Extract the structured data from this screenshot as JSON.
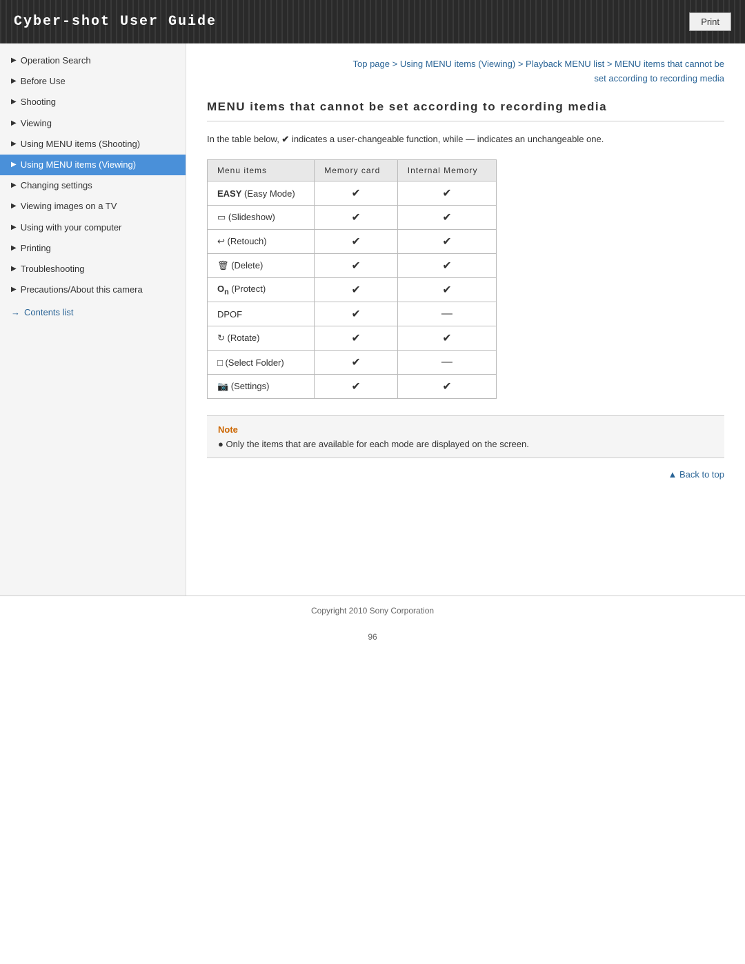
{
  "header": {
    "title": "Cyber-shot User Guide",
    "print_button": "Print"
  },
  "sidebar": {
    "items": [
      {
        "id": "operation-search",
        "label": "Operation Search",
        "active": false
      },
      {
        "id": "before-use",
        "label": "Before Use",
        "active": false
      },
      {
        "id": "shooting",
        "label": "Shooting",
        "active": false
      },
      {
        "id": "viewing",
        "label": "Viewing",
        "active": false
      },
      {
        "id": "using-menu-shooting",
        "label": "Using MENU items (Shooting)",
        "active": false
      },
      {
        "id": "using-menu-viewing",
        "label": "Using MENU items (Viewing)",
        "active": true
      },
      {
        "id": "changing-settings",
        "label": "Changing settings",
        "active": false
      },
      {
        "id": "viewing-images-tv",
        "label": "Viewing images on a TV",
        "active": false
      },
      {
        "id": "using-computer",
        "label": "Using with your computer",
        "active": false
      },
      {
        "id": "printing",
        "label": "Printing",
        "active": false
      },
      {
        "id": "troubleshooting",
        "label": "Troubleshooting",
        "active": false
      },
      {
        "id": "precautions",
        "label": "Precautions/About this camera",
        "active": false
      }
    ],
    "contents_list": "Contents list"
  },
  "breadcrumb": {
    "parts": [
      {
        "label": "Top page",
        "link": true
      },
      {
        "label": " > ",
        "link": false
      },
      {
        "label": "Using MENU items (Viewing)",
        "link": true
      },
      {
        "label": " > ",
        "link": false
      },
      {
        "label": "Playback MENU list",
        "link": true
      },
      {
        "label": " > ",
        "link": false
      },
      {
        "label": "MENU items that cannot be set according to recording media",
        "link": true
      }
    ]
  },
  "page": {
    "title": "MENU items that cannot be set according to recording media",
    "description": "In the table below,  ✔  indicates a user-changeable function, while — indicates an unchangeable one.",
    "table": {
      "headers": [
        "Menu items",
        "Memory card",
        "Internal Memory"
      ],
      "rows": [
        {
          "item": "EASY (Easy Mode)",
          "memory_card": "✔",
          "internal_memory": "✔",
          "easy": true
        },
        {
          "item": "⊡ (Slideshow)",
          "memory_card": "✔",
          "internal_memory": "✔"
        },
        {
          "item": "↩ (Retouch)",
          "memory_card": "✔",
          "internal_memory": "✔"
        },
        {
          "item": "🗑 (Delete)",
          "memory_card": "✔",
          "internal_memory": "✔"
        },
        {
          "item": "On (Protect)",
          "memory_card": "✔",
          "internal_memory": "✔"
        },
        {
          "item": "DPOF",
          "memory_card": "✔",
          "internal_memory": "—"
        },
        {
          "item": "⟳ (Rotate)",
          "memory_card": "✔",
          "internal_memory": "✔"
        },
        {
          "item": "□ (Select Folder)",
          "memory_card": "✔",
          "internal_memory": "—"
        },
        {
          "item": "⚙ (Settings)",
          "memory_card": "✔",
          "internal_memory": "✔"
        }
      ]
    },
    "note": {
      "title": "Note",
      "text": "● Only the items that are available for each mode are displayed on the screen."
    },
    "back_to_top": "▲ Back to top",
    "copyright": "Copyright 2010 Sony Corporation",
    "page_number": "96"
  }
}
